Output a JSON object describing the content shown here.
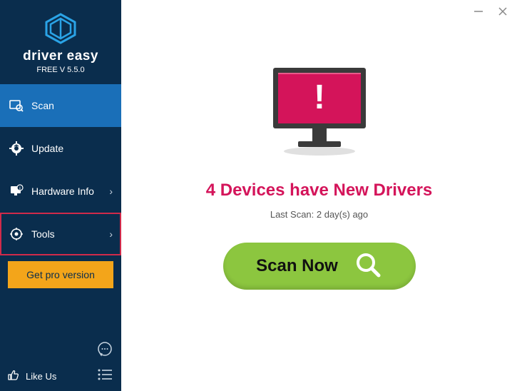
{
  "brand": {
    "name": "driver easy",
    "version": "FREE V 5.5.0"
  },
  "sidebar": {
    "items": [
      {
        "label": "Scan"
      },
      {
        "label": "Update"
      },
      {
        "label": "Hardware Info"
      },
      {
        "label": "Tools"
      }
    ],
    "pro_label": "Get pro version",
    "like_label": "Like Us"
  },
  "main": {
    "headline": "4 Devices have New Drivers",
    "last_scan": "Last Scan: 2 day(s) ago",
    "scan_button": "Scan Now"
  },
  "colors": {
    "sidebar_bg": "#0a2d4d",
    "accent_blue": "#1a6fb8",
    "pro_bg": "#f3a51a",
    "headline": "#d4145a",
    "scan_bg": "#8cc63f",
    "highlight_border": "#d02a4a",
    "monitor_screen": "#d4145a"
  }
}
